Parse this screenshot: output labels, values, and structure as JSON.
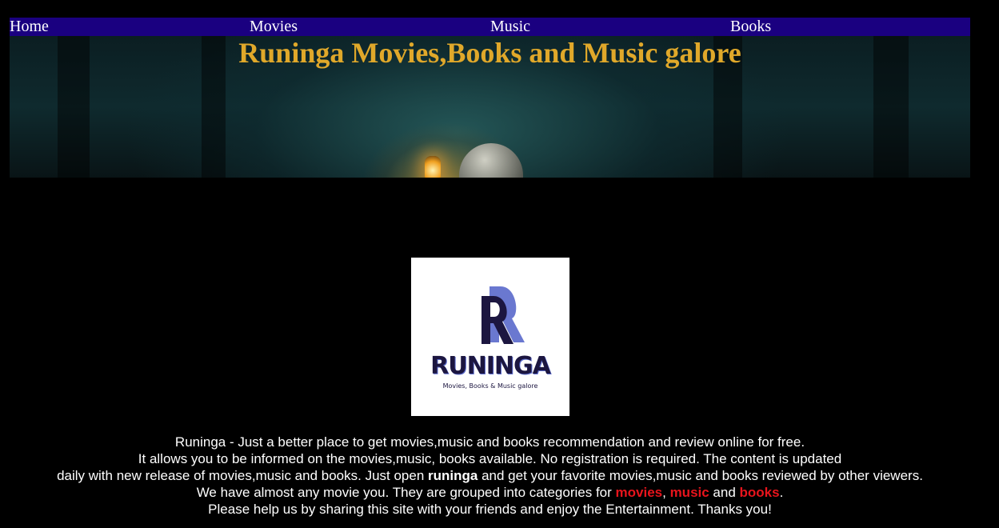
{
  "nav": {
    "items": [
      {
        "label": "Home"
      },
      {
        "label": "Movies"
      },
      {
        "label": "Music"
      },
      {
        "label": "Books"
      }
    ],
    "background": "#1a0080"
  },
  "hero": {
    "title": "Runinga Movies,Books and Music galore",
    "title_color": "#e0a82a"
  },
  "logo": {
    "letter": "R",
    "name": "RUNINGA",
    "tagline": "Movies, Books & Music galore",
    "accent_color": "#5a6acb"
  },
  "description": {
    "line1": "Runinga - Just a better place to get movies,music and books recommendation and review online for free.",
    "line2": "It allows you to be informed on the movies,music, books available. No registration is required. The content is updated",
    "line3_before": "daily with new release of movies,music and books. Just open ",
    "line3_bold": "runinga",
    "line3_after": " and get your favorite movies,music and books reviewed by other viewers.",
    "line4_before": "We have almost any movie you. They are grouped into categories for ",
    "link_movies": "movies",
    "sep_comma": ", ",
    "link_music": "music",
    "sep_and": " and ",
    "link_books": "books",
    "line4_end": ".",
    "line5": "Please help us by sharing this site with your friends and enjoy the Entertainment. Thanks you!",
    "link_color": "#e8141c"
  }
}
